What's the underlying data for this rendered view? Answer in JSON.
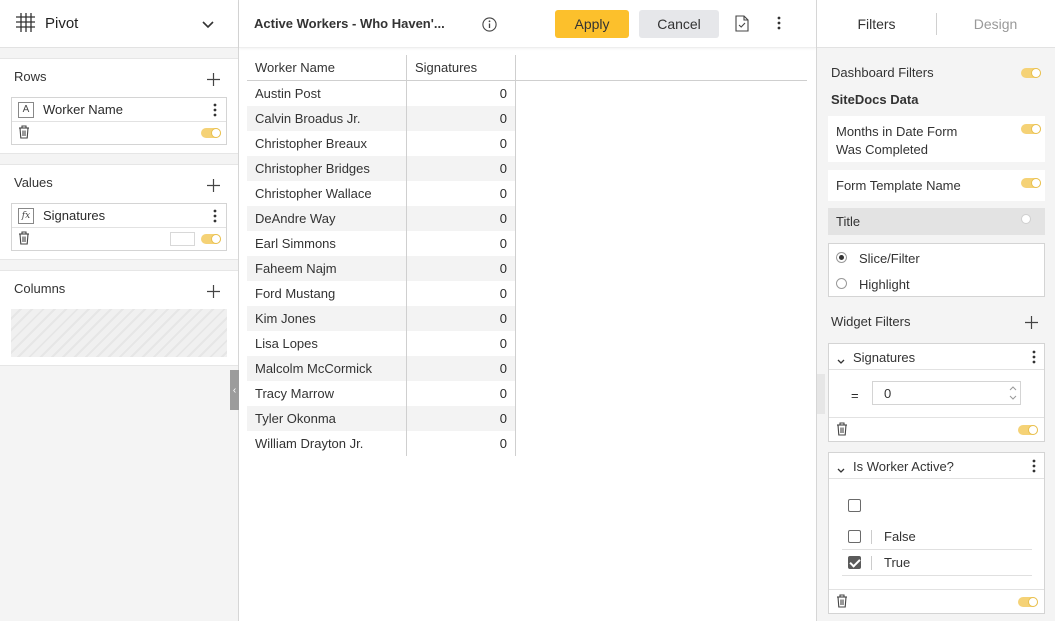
{
  "left_panel": {
    "title": "Pivot",
    "rows": {
      "title": "Rows",
      "fields": [
        {
          "type_glyph": "A",
          "name": "Worker Name"
        }
      ]
    },
    "values": {
      "title": "Values",
      "fields": [
        {
          "type_glyph": "fx",
          "name": "Signatures"
        }
      ]
    },
    "columns": {
      "title": "Columns"
    }
  },
  "toolbar": {
    "widget_title": "Active Workers - Who Haven'...",
    "apply_label": "Apply",
    "cancel_label": "Cancel"
  },
  "table": {
    "columns": [
      "Worker Name",
      "Signatures"
    ],
    "rows": [
      [
        "Austin Post",
        "0"
      ],
      [
        "Calvin Broadus Jr.",
        "0"
      ],
      [
        "Christopher Breaux",
        "0"
      ],
      [
        "Christopher Bridges",
        "0"
      ],
      [
        "Christopher Wallace",
        "0"
      ],
      [
        "DeAndre Way",
        "0"
      ],
      [
        "Earl Simmons",
        "0"
      ],
      [
        "Faheem Najm",
        "0"
      ],
      [
        "Ford Mustang",
        "0"
      ],
      [
        "Kim Jones",
        "0"
      ],
      [
        "Lisa Lopes",
        "0"
      ],
      [
        "Malcolm McCormick",
        "0"
      ],
      [
        "Tracy Marrow",
        "0"
      ],
      [
        "Tyler Okonma",
        "0"
      ],
      [
        "William Drayton Jr.",
        "0"
      ]
    ]
  },
  "right_panel": {
    "tabs": {
      "filters": "Filters",
      "design": "Design"
    },
    "dashboard_filters_label": "Dashboard Filters",
    "datasource_label": "SiteDocs Data",
    "dashboard_filters": [
      {
        "name": "Months in Date Form Was Completed",
        "enabled": true
      },
      {
        "name": "Form Template Name",
        "enabled": true
      },
      {
        "name": "Title",
        "enabled": false
      }
    ],
    "filter_mode": {
      "options": [
        "Slice/Filter",
        "Highlight"
      ],
      "selected": "Slice/Filter"
    },
    "widget_filters_label": "Widget Filters",
    "widget_filters": {
      "signatures": {
        "name": "Signatures",
        "operator": "=",
        "value": "0"
      },
      "is_worker_active": {
        "name": "Is Worker Active?",
        "options": [
          {
            "label": "False",
            "checked": false
          },
          {
            "label": "True",
            "checked": true
          }
        ]
      }
    }
  },
  "colors": {
    "accent": "#fcc02c",
    "toggle_on": "#f5d276",
    "cancel_bg": "#e6e7ea"
  }
}
